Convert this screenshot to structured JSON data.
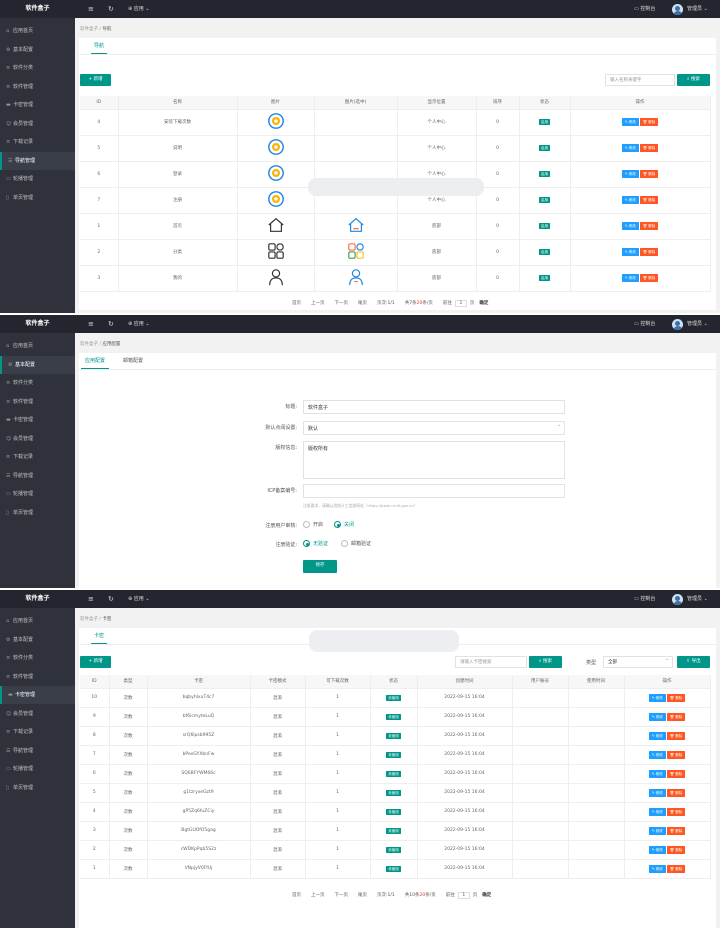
{
  "app": {
    "logo": "软件盒子",
    "menu_icon": "hamburger-icon",
    "refresh_icon": "refresh-icon",
    "app_menu": "应用",
    "console": "控制台",
    "user": "管理员"
  },
  "sidebar": {
    "items": [
      {
        "label": "应用首页",
        "icon": "home-icon"
      },
      {
        "label": "基本配置",
        "icon": "gear-icon"
      },
      {
        "label": "软件分类",
        "icon": "list-icon"
      },
      {
        "label": "软件管理",
        "icon": "list-icon"
      },
      {
        "label": "卡密管理",
        "icon": "card-icon"
      },
      {
        "label": "会员管理",
        "icon": "user-icon"
      },
      {
        "label": "下载记录",
        "icon": "list-icon"
      },
      {
        "label": "导航管理",
        "icon": "nav-icon"
      },
      {
        "label": "轮播管理",
        "icon": "carousel-icon"
      },
      {
        "label": "单页管理",
        "icon": "page-icon"
      }
    ]
  },
  "panel1": {
    "active_nav": 7,
    "breadcrumb": [
      "软件盒子",
      "导航"
    ],
    "tab": "导航",
    "add_button": "+ 新增",
    "search_placeholder": "输入名称关键字",
    "search_button": "搜索",
    "columns": [
      "ID",
      "名称",
      "图片",
      "图片(选中)",
      "显示位置",
      "排序",
      "状态",
      "操作"
    ],
    "rows": [
      {
        "id": "4",
        "name": "安装下载次数",
        "icon": "target-icon",
        "icon_sel": "",
        "pos": "个人中心",
        "sort": "0",
        "status": "启用"
      },
      {
        "id": "5",
        "name": "说明",
        "icon": "target-icon",
        "icon_sel": "",
        "pos": "个人中心",
        "sort": "0",
        "status": "启用"
      },
      {
        "id": "6",
        "name": "登录",
        "icon": "target-icon",
        "icon_sel": "",
        "pos": "个人中心",
        "sort": "0",
        "status": "启用"
      },
      {
        "id": "7",
        "name": "注册",
        "icon": "target-icon",
        "icon_sel": "",
        "pos": "个人中心",
        "sort": "0",
        "status": "启用"
      },
      {
        "id": "1",
        "name": "首页",
        "icon": "home-outline-icon",
        "icon_sel": "home-color-icon",
        "pos": "底部",
        "sort": "0",
        "status": "启用"
      },
      {
        "id": "2",
        "name": "分类",
        "icon": "grid-outline-icon",
        "icon_sel": "grid-color-icon",
        "pos": "底部",
        "sort": "0",
        "status": "启用"
      },
      {
        "id": "3",
        "name": "我的",
        "icon": "person-outline-icon",
        "icon_sel": "person-color-icon",
        "pos": "底部",
        "sort": "0",
        "status": "启用"
      }
    ],
    "edit_label": "修改",
    "delete_label": "删除",
    "pager": {
      "first": "首页",
      "prev": "上一页",
      "next": "下一页",
      "last": "尾页",
      "page_info": "页次:1/1",
      "total_prefix": "共7条",
      "total_num": "20",
      "total_suffix": "条/页",
      "goto": "前往",
      "page": "1",
      "page_unit": "页",
      "confirm": "确定"
    }
  },
  "panel2": {
    "active_nav": 1,
    "breadcrumb": [
      "软件盒子",
      "应用配置"
    ],
    "tabs": [
      "应用配置",
      "邮箱配置"
    ],
    "fields": {
      "title_label": "标题:",
      "title_value": "软件盒子",
      "default_label": "默认点阅设置:",
      "default_value": "默认",
      "copyright_label": "版权信息:",
      "copyright_value": "版权所有",
      "icp_label": "ICP备案编号:",
      "icp_value": "",
      "icp_hint": "注册要求，请确认用统计工信部网站（https://beian.miit.gov.cn）",
      "review_label": "注册用户审核:",
      "review_on": "开启",
      "review_off": "关闭",
      "verify_label": "注册验证:",
      "verify_none": "无验证",
      "verify_email": "邮箱验证",
      "save_button": "保存"
    }
  },
  "panel3": {
    "active_nav": 4,
    "breadcrumb": [
      "软件盒子",
      "卡密"
    ],
    "tab": "卡密",
    "add_button": "+ 新增",
    "search_placeholder": "请输入卡密搜索",
    "search_button": "搜索",
    "type_label": "类型",
    "type_value": "全部",
    "export_button": "导出",
    "columns": [
      "ID",
      "类型",
      "卡密",
      "卡密模式",
      "可下载次数",
      "状态",
      "创建时间",
      "用户账号",
      "使用时间",
      "操作"
    ],
    "rows": [
      {
        "id": "10",
        "type": "次数",
        "code": "bqbyhlxuT4c7",
        "mode": "混淆",
        "count": "1",
        "status": "未使用",
        "created": "2022-09-15 16:04"
      },
      {
        "id": "9",
        "type": "次数",
        "code": "bf6icmyteLuQ",
        "mode": "混淆",
        "count": "1",
        "status": "未使用",
        "created": "2022-09-15 16:04"
      },
      {
        "id": "8",
        "type": "次数",
        "code": "srQ6lpsb995Z",
        "mode": "混淆",
        "count": "1",
        "status": "未使用",
        "created": "2022-09-15 16:04"
      },
      {
        "id": "7",
        "type": "次数",
        "code": "bPexGYXbnFw",
        "mode": "混淆",
        "count": "1",
        "status": "未使用",
        "created": "2022-09-15 16:04"
      },
      {
        "id": "6",
        "type": "次数",
        "code": "SQ6BFYWM66c",
        "mode": "混淆",
        "count": "1",
        "status": "未使用",
        "created": "2022-09-15 16:04"
      },
      {
        "id": "5",
        "type": "次数",
        "code": "g1tzryxeGzt9",
        "mode": "混淆",
        "count": "1",
        "status": "未使用",
        "created": "2022-09-15 16:04"
      },
      {
        "id": "4",
        "type": "次数",
        "code": "gP5Zq6fuZCiy",
        "mode": "混淆",
        "count": "1",
        "status": "未使用",
        "created": "2022-09-15 16:04"
      },
      {
        "id": "3",
        "type": "次数",
        "code": "BgtGUOfO5gag",
        "mode": "混淆",
        "count": "1",
        "status": "未使用",
        "created": "2022-09-15 16:04"
      },
      {
        "id": "2",
        "type": "次数",
        "code": "cWDKpPqb5S2z",
        "mode": "混淆",
        "count": "1",
        "status": "未使用",
        "created": "2022-09-15 16:04"
      },
      {
        "id": "1",
        "type": "次数",
        "code": "VNpjyV0FfUj",
        "mode": "混淆",
        "count": "1",
        "status": "未使用",
        "created": "2022-09-15 16:04"
      }
    ],
    "edit_label": "修改",
    "delete_label": "删除",
    "pager": {
      "first": "首页",
      "prev": "上一页",
      "next": "下一页",
      "last": "尾页",
      "page_info": "页次:1/1",
      "total_prefix": "共10条",
      "total_num": "20",
      "total_suffix": "条/页",
      "goto": "前往",
      "page": "1",
      "page_unit": "页",
      "confirm": "确定"
    }
  }
}
